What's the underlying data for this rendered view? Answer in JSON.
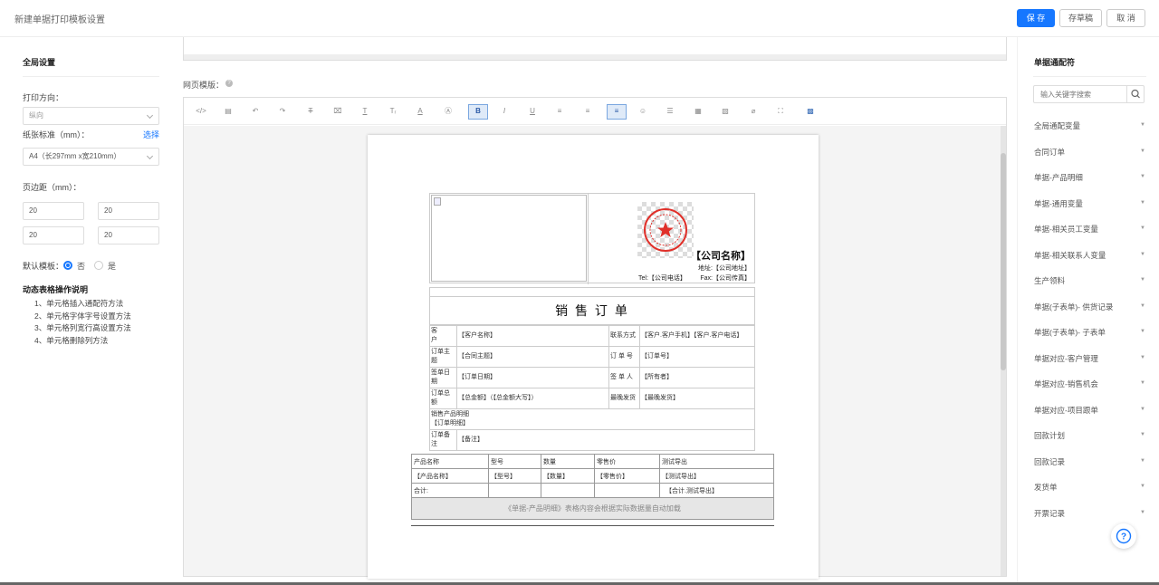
{
  "header": {
    "title": "新建单据打印模板设置",
    "save": "保 存",
    "draft": "存草稿",
    "cancel": "取 消"
  },
  "left": {
    "global_title": "全局设置",
    "orientation_label": "打印方向：",
    "orientation_value": "纵向",
    "paper_label": "纸张标准（mm）：",
    "paper_link": "选择",
    "paper_value": "A4（长297mm x宽210mm）",
    "margin_label": "页边距（mm）：",
    "margins": [
      "20",
      "20",
      "20",
      "20"
    ],
    "default_label": "默认模板：",
    "default_no": "否",
    "default_yes": "是",
    "help_title": "动态表格操作说明",
    "help_items": [
      "1、单元格插入通配符方法",
      "2、单元格字体字号设置方法",
      "3、单元格列宽行高设置方法",
      "4、单元格删除列方法"
    ]
  },
  "editor": {
    "label": "网页模版："
  },
  "doc": {
    "company_name": "【公司名称】",
    "address": "地址:【公司地址】",
    "tel": "Tel:【公司电话】",
    "fax": "Fax:【公司传真】",
    "title": "销 售 订 单",
    "rows": [
      [
        "客　　户",
        "【客户名称】",
        "联系方式",
        "【客户.客户手机】【客户.客户电话】"
      ],
      [
        "订单主题",
        "【合同主题】",
        "订 单 号",
        "【订单号】"
      ],
      [
        "签单日期",
        "【订单日期】",
        "签 单 人",
        "【所有者】"
      ],
      [
        "订单总额",
        "【总金额】（【总金额大写】）",
        "最晚发货",
        "【最晚发货】"
      ]
    ],
    "product_label": "销售产品明细",
    "product_value": "【订单明细】",
    "remark_label": "订单备注",
    "remark_value": "【备注】",
    "product_headers": [
      "产品名称",
      "型号",
      "数量",
      "零售价",
      "测试导出"
    ],
    "product_row": [
      "【产品名称】",
      "【型号】",
      "【数量】",
      "【零售价】",
      "【测试导出】"
    ],
    "total_label": "合计:",
    "total_value": "【合计.测试导出】",
    "note": "《单据-产品明细》表格内容会根据实际数据量自动加载"
  },
  "right": {
    "title": "单据通配符",
    "search_placeholder": "输入关键字搜索",
    "categories": [
      "全局通配变量",
      "合同订单",
      "单据-产品明细",
      "单据-通用变量",
      "单据-相关员工变量",
      "单据-相关联系人变量",
      "生产领料",
      "单据(子表单)- 供货记录",
      "单据(子表单)- 子表单",
      "单据对应-客户管理",
      "单据对应-销售机会",
      "单据对应-项目跟单",
      "回款计划",
      "回款记录",
      "发货单",
      "开票记录"
    ]
  },
  "colors": {
    "accent": "#1677ff",
    "stamp": "#e0302a"
  }
}
